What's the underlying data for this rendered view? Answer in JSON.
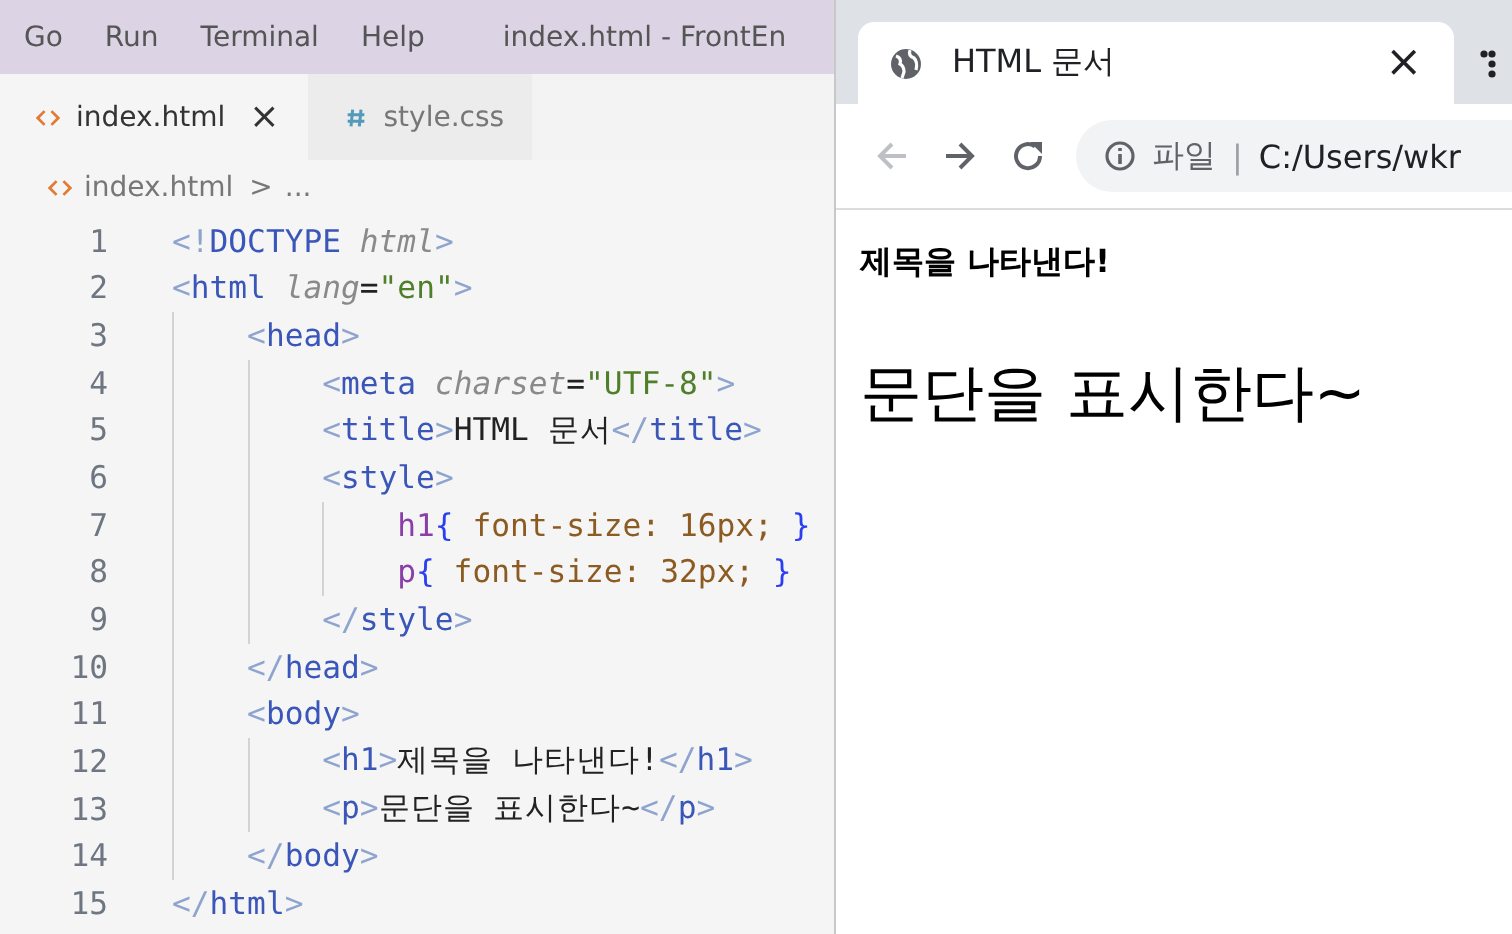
{
  "editor": {
    "menu": [
      "Go",
      "Run",
      "Terminal",
      "Help"
    ],
    "title": "index.html - FrontEn",
    "tabs": [
      {
        "label": "index.html",
        "kind": "html",
        "selected": true,
        "close": "×"
      },
      {
        "label": "style.css",
        "kind": "css",
        "selected": false
      }
    ],
    "breadcrumb": {
      "file": "index.html",
      "separator": ">",
      "rest": "..."
    },
    "lines": [
      {
        "n": "1",
        "tokens": [
          {
            "t": "<!",
            "kind": "punct"
          },
          {
            "t": "DOCTYPE",
            "kind": "tag"
          },
          {
            "t": " html",
            "kind": "attr"
          },
          {
            "t": ">",
            "kind": "punct"
          }
        ]
      },
      {
        "n": "2",
        "tokens": [
          {
            "t": "<",
            "kind": "punct"
          },
          {
            "t": "html",
            "kind": "tag"
          },
          {
            "t": " lang",
            "kind": "attr"
          },
          {
            "t": "=",
            "kind": "text"
          },
          {
            "t": "\"en\"",
            "kind": "str"
          },
          {
            "t": ">",
            "kind": "punct"
          }
        ],
        "children": [
          {
            "n": "3",
            "tokens": [
              {
                "t": "<",
                "kind": "punct"
              },
              {
                "t": "head",
                "kind": "tag"
              },
              {
                "t": ">",
                "kind": "punct"
              }
            ],
            "children": [
              {
                "n": "4",
                "tokens": [
                  {
                    "t": "<",
                    "kind": "punct"
                  },
                  {
                    "t": "meta",
                    "kind": "tag"
                  },
                  {
                    "t": " charset",
                    "kind": "attr"
                  },
                  {
                    "t": "=",
                    "kind": "text"
                  },
                  {
                    "t": "\"UTF-8\"",
                    "kind": "str"
                  },
                  {
                    "t": ">",
                    "kind": "punct"
                  }
                ]
              },
              {
                "n": "5",
                "tokens": [
                  {
                    "t": "<",
                    "kind": "punct"
                  },
                  {
                    "t": "title",
                    "kind": "tag"
                  },
                  {
                    "t": ">",
                    "kind": "punct"
                  },
                  {
                    "t": "HTML 문서",
                    "kind": "text"
                  },
                  {
                    "t": "</",
                    "kind": "punct"
                  },
                  {
                    "t": "title",
                    "kind": "tag"
                  },
                  {
                    "t": ">",
                    "kind": "punct"
                  }
                ]
              },
              {
                "n": "6",
                "tokens": [
                  {
                    "t": "<",
                    "kind": "punct"
                  },
                  {
                    "t": "style",
                    "kind": "tag"
                  },
                  {
                    "t": ">",
                    "kind": "punct"
                  }
                ],
                "children": [
                  {
                    "n": "7",
                    "tokens": [
                      {
                        "t": "h1",
                        "kind": "sel"
                      },
                      {
                        "t": "{",
                        "kind": "brace"
                      },
                      {
                        "t": " font-size: 16px; ",
                        "kind": "prop"
                      },
                      {
                        "t": "}",
                        "kind": "brace"
                      }
                    ]
                  },
                  {
                    "n": "8",
                    "tokens": [
                      {
                        "t": "p",
                        "kind": "sel"
                      },
                      {
                        "t": "{",
                        "kind": "brace"
                      },
                      {
                        "t": " font-size: 32px; ",
                        "kind": "prop"
                      },
                      {
                        "t": "}",
                        "kind": "brace"
                      }
                    ]
                  }
                ]
              },
              {
                "n": "9",
                "tokens": [
                  {
                    "t": "</",
                    "kind": "punct"
                  },
                  {
                    "t": "style",
                    "kind": "tag"
                  },
                  {
                    "t": ">",
                    "kind": "punct"
                  }
                ]
              }
            ]
          },
          {
            "n": "10",
            "tokens": [
              {
                "t": "</",
                "kind": "punct"
              },
              {
                "t": "head",
                "kind": "tag"
              },
              {
                "t": ">",
                "kind": "punct"
              }
            ]
          },
          {
            "n": "11",
            "tokens": [
              {
                "t": "<",
                "kind": "punct"
              },
              {
                "t": "body",
                "kind": "tag"
              },
              {
                "t": ">",
                "kind": "punct"
              }
            ],
            "children": [
              {
                "n": "12",
                "tokens": [
                  {
                    "t": "<",
                    "kind": "punct"
                  },
                  {
                    "t": "h1",
                    "kind": "tag"
                  },
                  {
                    "t": ">",
                    "kind": "punct"
                  },
                  {
                    "t": "제목을 나타낸다!",
                    "kind": "text"
                  },
                  {
                    "t": "</",
                    "kind": "punct"
                  },
                  {
                    "t": "h1",
                    "kind": "tag"
                  },
                  {
                    "t": ">",
                    "kind": "punct"
                  }
                ]
              },
              {
                "n": "13",
                "tokens": [
                  {
                    "t": "<",
                    "kind": "punct"
                  },
                  {
                    "t": "p",
                    "kind": "tag"
                  },
                  {
                    "t": ">",
                    "kind": "punct"
                  },
                  {
                    "t": "문단을 표시한다~",
                    "kind": "text"
                  },
                  {
                    "t": "</",
                    "kind": "punct"
                  },
                  {
                    "t": "p",
                    "kind": "tag"
                  },
                  {
                    "t": ">",
                    "kind": "punct"
                  }
                ]
              }
            ]
          },
          {
            "n": "14",
            "tokens": [
              {
                "t": "</",
                "kind": "punct"
              },
              {
                "t": "body",
                "kind": "tag"
              },
              {
                "t": ">",
                "kind": "punct"
              }
            ]
          }
        ]
      },
      {
        "n": "15",
        "tokens": [
          {
            "t": "</",
            "kind": "punct"
          },
          {
            "t": "html",
            "kind": "tag"
          },
          {
            "t": ">",
            "kind": "punct"
          }
        ]
      }
    ]
  },
  "browser": {
    "tab": {
      "title": "HTML 문서",
      "close": "×"
    },
    "address": {
      "scheme": "파일",
      "separator": "|",
      "url": "C:/Users/wkr"
    },
    "page": {
      "heading": "제목을 나타낸다!",
      "paragraph": "문단을 표시한다~"
    }
  }
}
